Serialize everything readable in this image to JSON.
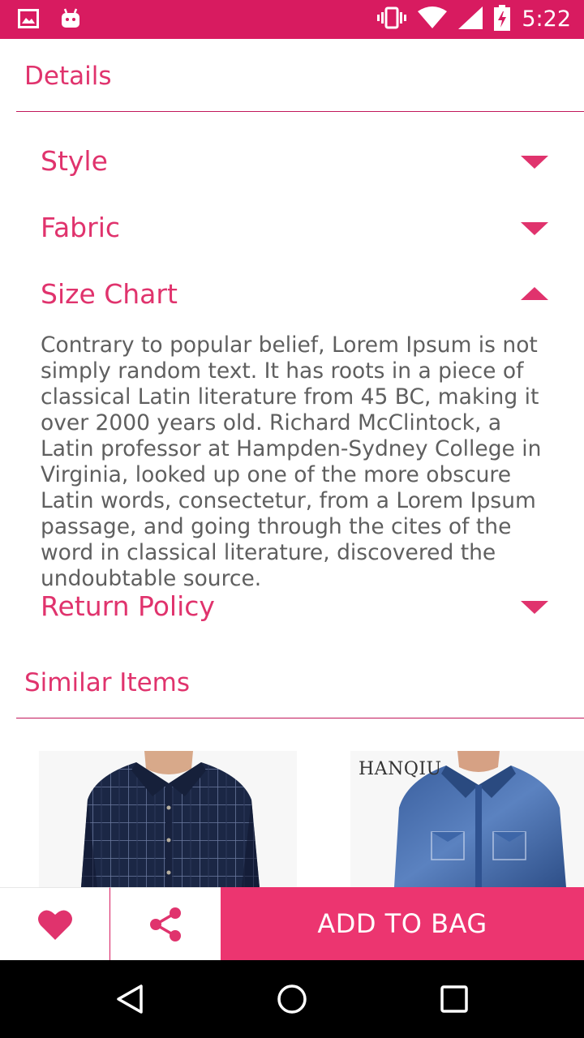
{
  "status_bar": {
    "time": "5:22",
    "icons": [
      "image-icon",
      "android-icon",
      "vibrate-icon",
      "wifi-icon",
      "cell-signal-icon",
      "battery-charging-icon"
    ]
  },
  "details": {
    "header": "Details",
    "accordion": [
      {
        "label": "Style",
        "expanded": false
      },
      {
        "label": "Fabric",
        "expanded": false
      },
      {
        "label": "Size Chart",
        "expanded": true,
        "body": "Contrary to popular belief, Lorem Ipsum is not simply random text. It has roots in a piece of classical Latin literature from 45 BC, making it over 2000 years old. Richard McClintock, a Latin professor at Hampden-Sydney College in Virginia, looked up one of the more obscure Latin words, consectetur, from a Lorem Ipsum passage, and going through the cites of the word in classical literature, discovered the undoubtable source."
      },
      {
        "label": "Return Policy",
        "expanded": false
      }
    ]
  },
  "similar": {
    "header": "Similar Items",
    "items": [
      {
        "brand": ""
      },
      {
        "brand": "HANQIU"
      }
    ]
  },
  "actions": {
    "favorite_icon": "heart-icon",
    "share_icon": "share-icon",
    "add_to_bag": "ADD TO BAG"
  },
  "colors": {
    "accent": "#e0336d",
    "status_bar": "#d81b60",
    "button": "#ec3570"
  }
}
